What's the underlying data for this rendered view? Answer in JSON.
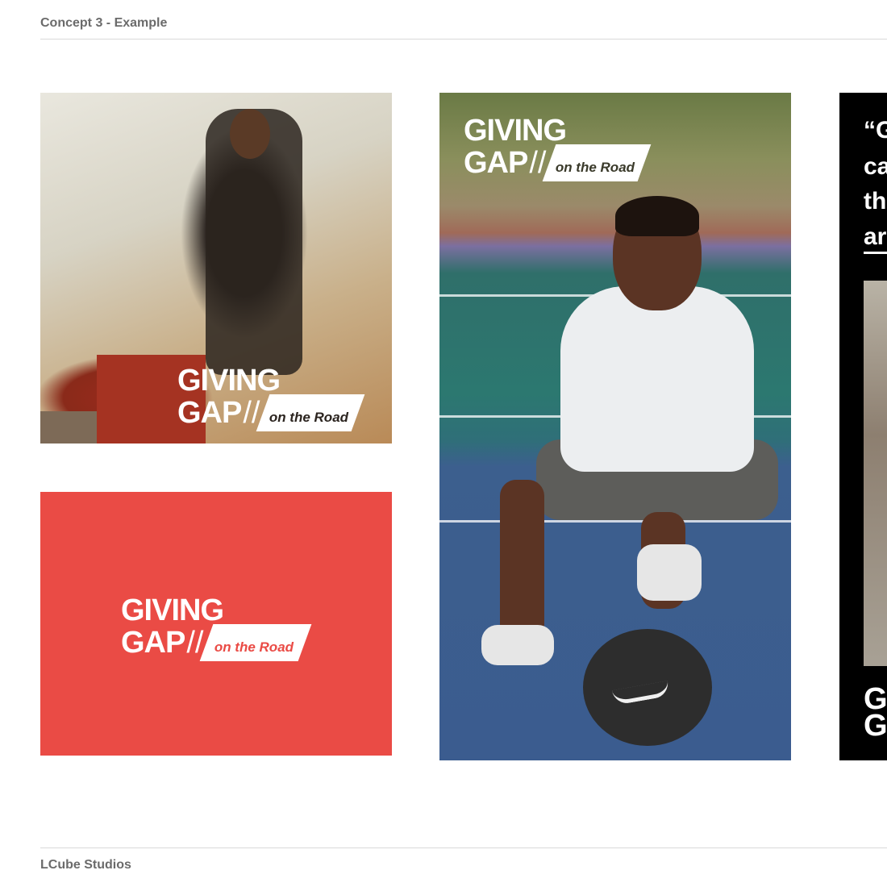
{
  "header": {
    "title": "Concept 3 - Example"
  },
  "footer": {
    "studio": "LCube Studios"
  },
  "logo": {
    "line1": "GIVING",
    "line2": "GAP",
    "slash": "//",
    "tagline": "on the Road"
  },
  "quote_card": {
    "lines": [
      "“G",
      "ca",
      "th",
      "ar"
    ],
    "logo_fragment": [
      "G",
      "G"
    ]
  },
  "colors": {
    "red_card": "#ea4b45",
    "quote_card": "#000000",
    "rule": "#d9d9d9",
    "header_text": "#6b6b6b"
  }
}
